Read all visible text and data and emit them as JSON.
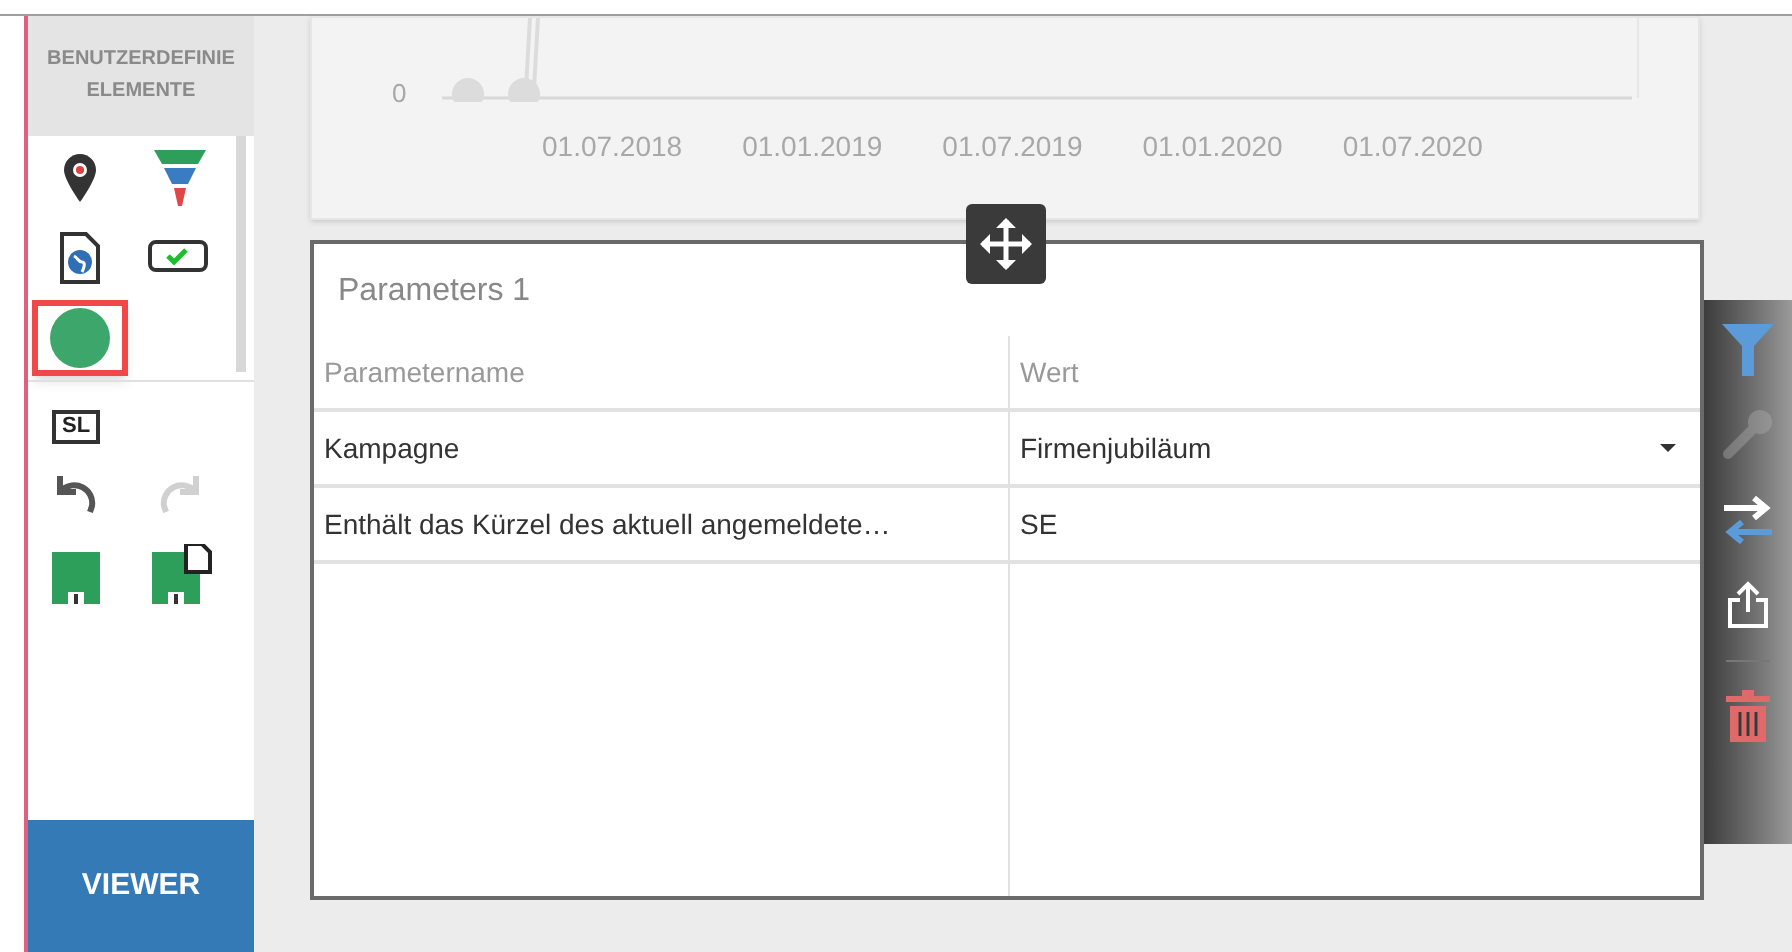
{
  "sidebar": {
    "header_lines": [
      "BENUTZERDEFINIE",
      "ELEMENTE"
    ],
    "tools": [
      {
        "kind": "pin",
        "selected": false
      },
      {
        "kind": "funnel",
        "selected": false
      },
      {
        "kind": "globe-doc",
        "selected": false
      },
      {
        "kind": "checkbox",
        "selected": false
      },
      {
        "kind": "circle",
        "selected": true
      }
    ],
    "sl_button": "SL",
    "history": [
      {
        "kind": "undo",
        "disabled": false
      },
      {
        "kind": "redo",
        "disabled": true
      }
    ],
    "save": [
      {
        "kind": "save"
      },
      {
        "kind": "save-as"
      }
    ],
    "viewer_button": "VIEWER"
  },
  "chart": {
    "y_labels": [
      "0"
    ],
    "x_labels": [
      "01.07.2018",
      "01.01.2019",
      "01.07.2019",
      "01.01.2020",
      "01.07.2020"
    ]
  },
  "panel": {
    "title": "Parameters 1",
    "columns": [
      "Parametername",
      "Wert"
    ],
    "rows": [
      {
        "name": "Kampagne",
        "value": "Firmenjubiläum",
        "dropdown": true
      },
      {
        "name": "Enthält das Kürzel des aktuell angemeldete…",
        "value": "SE",
        "dropdown": false
      }
    ]
  },
  "toolbar": [
    {
      "kind": "filter",
      "disabled": false
    },
    {
      "kind": "wrench",
      "disabled": true
    },
    {
      "kind": "swap",
      "disabled": false
    },
    {
      "kind": "export",
      "disabled": false
    },
    {
      "kind": "delete",
      "disabled": false
    }
  ]
}
